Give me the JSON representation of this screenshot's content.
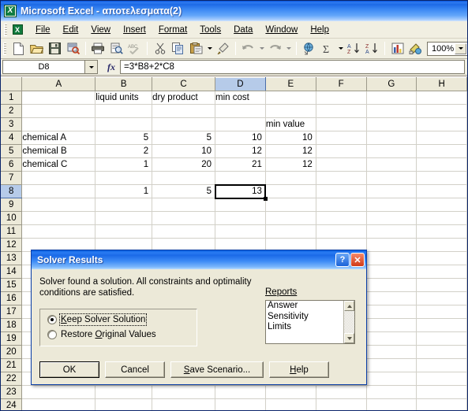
{
  "window": {
    "title": "Microsoft Excel - αποτελεσματα(2)",
    "app_icon": "excel-icon"
  },
  "menubar": {
    "items": [
      {
        "label": "File"
      },
      {
        "label": "Edit"
      },
      {
        "label": "View"
      },
      {
        "label": "Insert"
      },
      {
        "label": "Format"
      },
      {
        "label": "Tools"
      },
      {
        "label": "Data"
      },
      {
        "label": "Window"
      },
      {
        "label": "Help"
      }
    ]
  },
  "toolbar": {
    "buttons": [
      "new-icon",
      "open-icon",
      "save-icon",
      "print-search-icon",
      "print-icon",
      "print-preview-icon",
      "spelling-icon",
      "cut-icon",
      "copy-icon",
      "paste-icon",
      "format-painter-icon",
      "undo-icon",
      "redo-icon",
      "hyperlink-icon",
      "autosum-icon",
      "sort-ascending-icon",
      "sort-descending-icon",
      "chart-wizard-icon",
      "drawing-icon"
    ],
    "zoom_value": "100%"
  },
  "formula_bar": {
    "name_box_value": "D8",
    "fx_label": "fx",
    "formula_value": "=3*B8+2*C8"
  },
  "sheet": {
    "columns": [
      "A",
      "B",
      "C",
      "D",
      "E",
      "F",
      "G",
      "H"
    ],
    "selected_column": "D",
    "selected_row": 8,
    "selected_cell": "D8",
    "rows": [
      {
        "n": 1,
        "cells": {
          "B": "liquid units",
          "C": "dry product",
          "D": "min cost"
        }
      },
      {
        "n": 2,
        "cells": {}
      },
      {
        "n": 3,
        "cells": {
          "E": "min value"
        }
      },
      {
        "n": 4,
        "cells": {
          "A": "chemical A",
          "B": "5",
          "C": "5",
          "D": "10",
          "E": "10"
        }
      },
      {
        "n": 5,
        "cells": {
          "A": "chemical B",
          "B": "2",
          "C": "10",
          "D": "12",
          "E": "12"
        }
      },
      {
        "n": 6,
        "cells": {
          "A": "chemical C",
          "B": "1",
          "C": "20",
          "D": "21",
          "E": "12"
        }
      },
      {
        "n": 7,
        "cells": {}
      },
      {
        "n": 8,
        "cells": {
          "B": "1",
          "C": "5",
          "D": "13"
        }
      },
      {
        "n": 9,
        "cells": {}
      },
      {
        "n": 10,
        "cells": {}
      },
      {
        "n": 11,
        "cells": {}
      },
      {
        "n": 12,
        "cells": {}
      },
      {
        "n": 13,
        "cells": {}
      },
      {
        "n": 14,
        "cells": {}
      },
      {
        "n": 15,
        "cells": {}
      },
      {
        "n": 16,
        "cells": {}
      },
      {
        "n": 17,
        "cells": {}
      },
      {
        "n": 18,
        "cells": {}
      },
      {
        "n": 19,
        "cells": {}
      },
      {
        "n": 20,
        "cells": {}
      },
      {
        "n": 21,
        "cells": {}
      },
      {
        "n": 22,
        "cells": {}
      },
      {
        "n": 23,
        "cells": {}
      },
      {
        "n": 24,
        "cells": {}
      }
    ],
    "text_columns": [
      "A",
      "B",
      "C",
      "D",
      "E"
    ],
    "numeric_cells": [
      "B4",
      "C4",
      "D4",
      "E4",
      "B5",
      "C5",
      "D5",
      "E5",
      "B6",
      "C6",
      "D6",
      "E6",
      "B8",
      "C8",
      "D8"
    ]
  },
  "dialog": {
    "title": "Solver Results",
    "help_button": "?",
    "close_button": "✕",
    "message": "Solver found a solution.  All constraints and optimality conditions are satisfied.",
    "reports_label": "Reports",
    "reports_items": [
      "Answer",
      "Sensitivity",
      "Limits"
    ],
    "radio_options": [
      {
        "label": "Keep Solver Solution",
        "selected": true,
        "accesskey": "K"
      },
      {
        "label": "Restore Original Values",
        "selected": false,
        "accesskey": "O"
      }
    ],
    "buttons": [
      {
        "label": "OK",
        "default": true
      },
      {
        "label": "Cancel",
        "default": false
      },
      {
        "label": "Save Scenario...",
        "default": false
      },
      {
        "label": "Help",
        "default": false
      }
    ]
  },
  "colors": {
    "title_blue": "#1b6ae8",
    "toolbar_bg": "#f1efe2",
    "dialog_bg": "#ece9d8",
    "header_bg": "#ece9d8",
    "selection_blue": "#b6cbe9",
    "grid_line": "#d2d0c8"
  }
}
